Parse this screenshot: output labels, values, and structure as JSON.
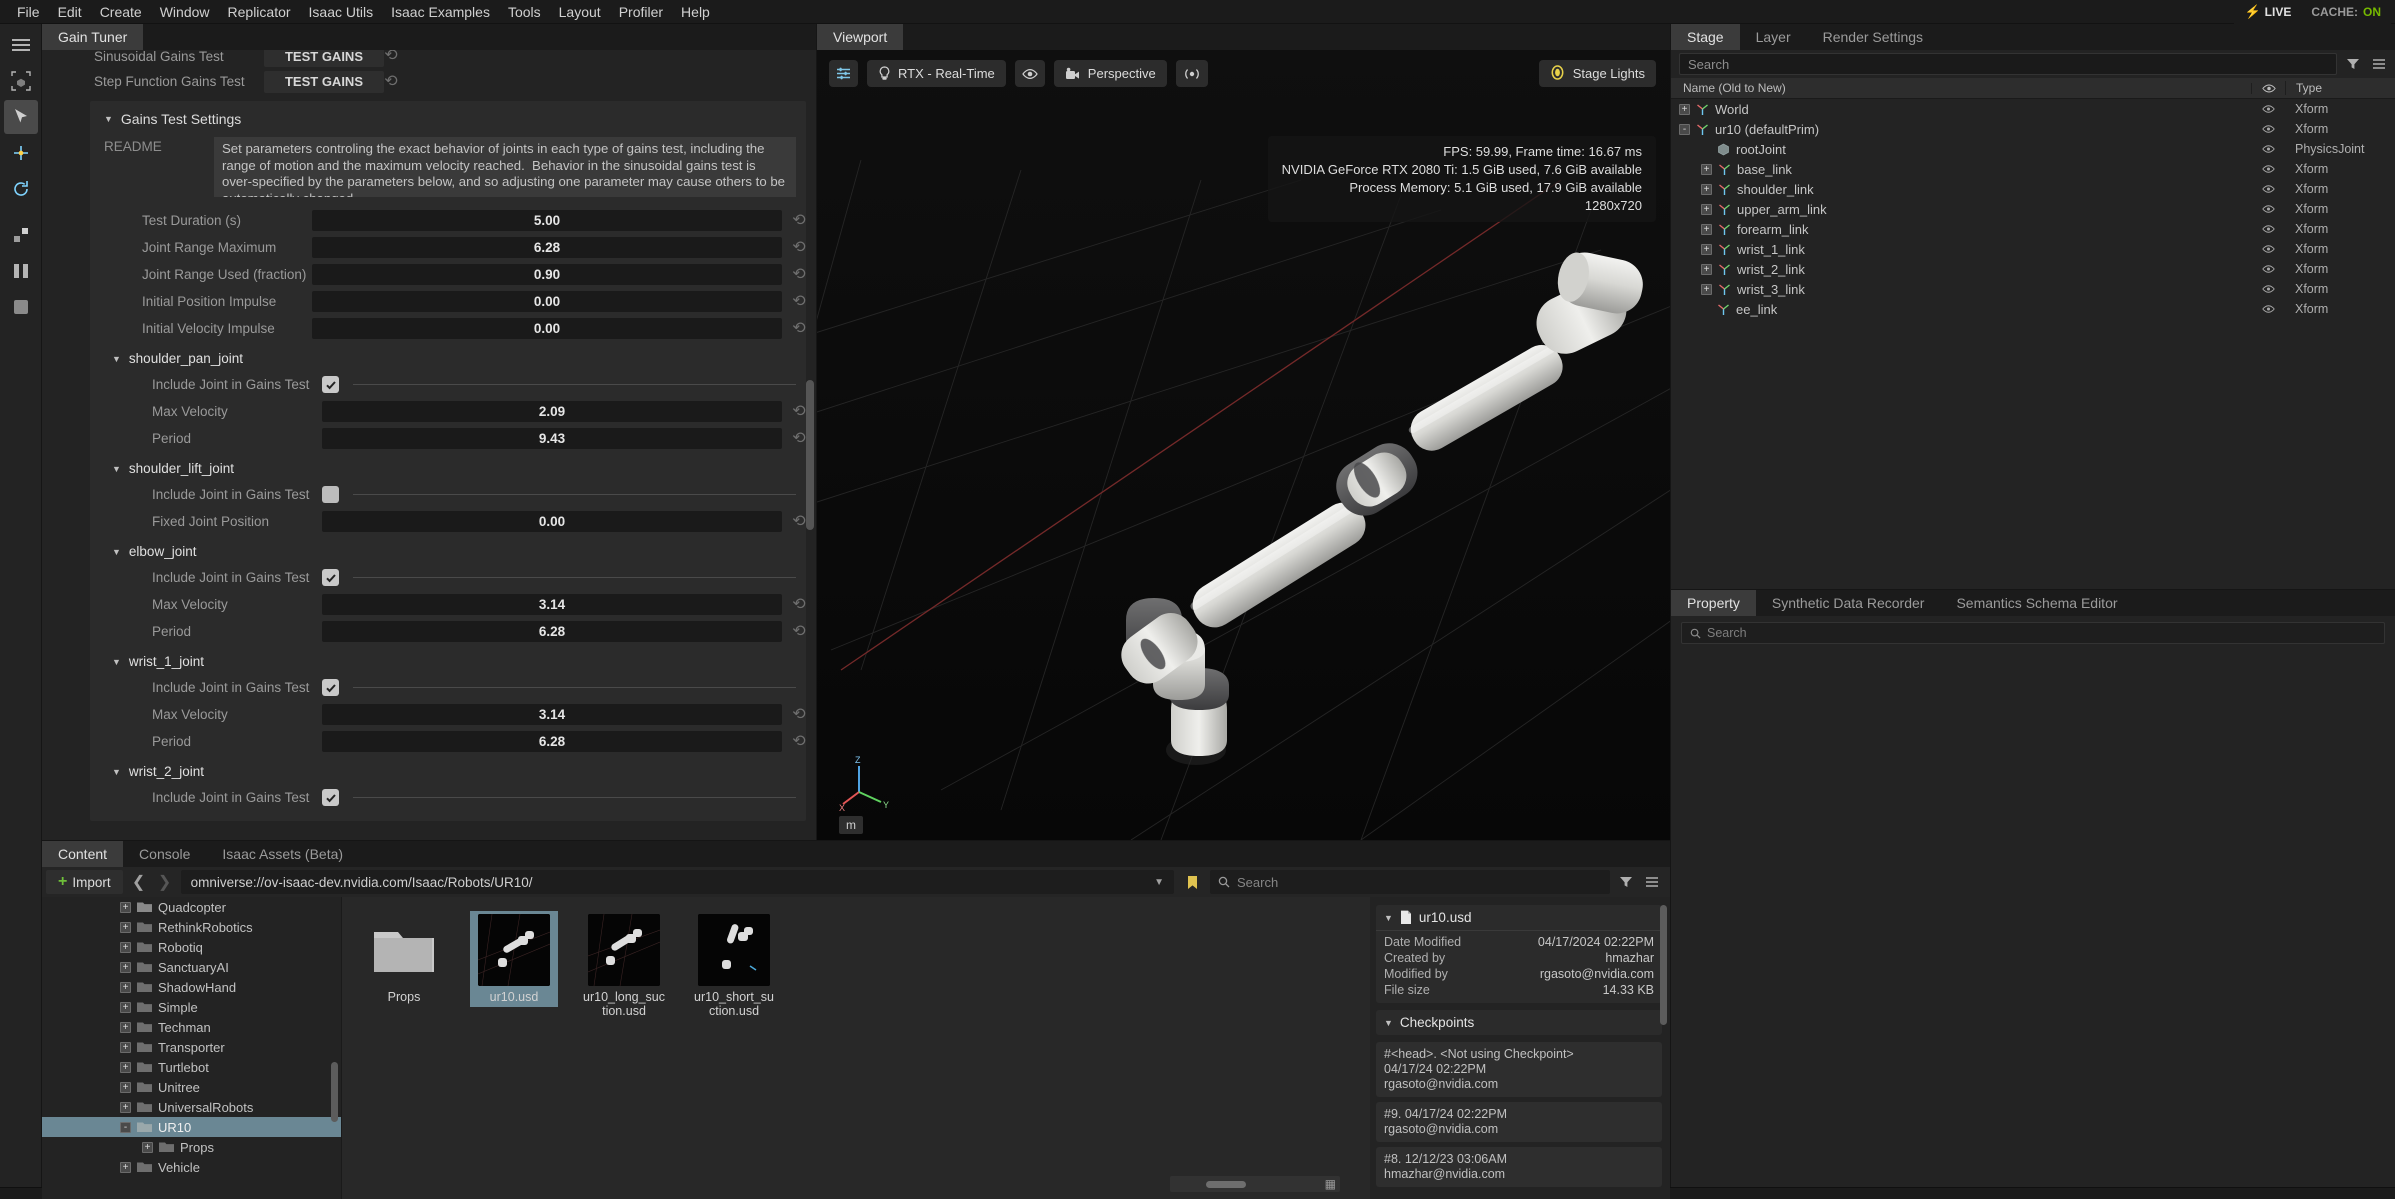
{
  "menubar": {
    "items": [
      "File",
      "Edit",
      "Create",
      "Window",
      "Replicator",
      "Isaac Utils",
      "Isaac Examples",
      "Tools",
      "Layout",
      "Profiler",
      "Help"
    ],
    "live_label": "LIVE",
    "cache_label": "CACHE:",
    "cache_state": "ON",
    "accent_green": "#76b900",
    "accent_yellow": "#ffd200"
  },
  "gain_tuner": {
    "tabs": [
      {
        "label": "Gain Tuner",
        "active": true
      }
    ],
    "top_rows": [
      {
        "label": "Sinusoidal Gains Test",
        "button": "TEST GAINS"
      },
      {
        "label": "Step Function Gains Test",
        "button": "TEST GAINS"
      }
    ],
    "settings_group": {
      "title": "Gains Test Settings",
      "readme_label": "README",
      "readme_text": "Set parameters controling the exact behavior of joints in each type of gains test, including the range of motion and the maximum velocity reached.  Behavior in the sinusoidal gains test is over-specified by the parameters below, and so adjusting one parameter may cause others to be automatically changed.\n\nMax Velocity and Period are exclusive to the sinusoidal gains test. Period is bounded below by Max Velocity and",
      "params": [
        {
          "label": "Test Duration (s)",
          "value": "5.00"
        },
        {
          "label": "Joint Range Maximum",
          "value": "6.28"
        },
        {
          "label": "Joint Range Used (fraction)",
          "value": "0.90"
        },
        {
          "label": "Initial Position Impulse",
          "value": "0.00"
        },
        {
          "label": "Initial Velocity Impulse",
          "value": "0.00"
        }
      ],
      "joints": [
        {
          "name": "shoulder_pan_joint",
          "include_label": "Include Joint in Gains Test",
          "included": true,
          "fields": [
            {
              "label": "Max Velocity",
              "value": "2.09"
            },
            {
              "label": "Period",
              "value": "9.43"
            }
          ]
        },
        {
          "name": "shoulder_lift_joint",
          "include_label": "Include Joint in Gains Test",
          "included": false,
          "fields": [
            {
              "label": "Fixed Joint Position",
              "value": "0.00"
            }
          ]
        },
        {
          "name": "elbow_joint",
          "include_label": "Include Joint in Gains Test",
          "included": true,
          "fields": [
            {
              "label": "Max Velocity",
              "value": "3.14"
            },
            {
              "label": "Period",
              "value": "6.28"
            }
          ]
        },
        {
          "name": "wrist_1_joint",
          "include_label": "Include Joint in Gains Test",
          "included": true,
          "fields": [
            {
              "label": "Max Velocity",
              "value": "3.14"
            },
            {
              "label": "Period",
              "value": "6.28"
            }
          ]
        },
        {
          "name": "wrist_2_joint",
          "include_label": "Include Joint in Gains Test",
          "included": true,
          "fields": []
        }
      ]
    }
  },
  "viewport": {
    "tabs": [
      {
        "label": "Viewport",
        "active": true
      }
    ],
    "toolbar": {
      "settings_icon": "sliders-icon",
      "renderer": "RTX - Real-Time",
      "renderer_icon": "lightbulb-icon",
      "visibility_icon": "eye-icon",
      "camera": "Perspective",
      "camera_icon": "camera-icon",
      "sensor_icon": "broadcast-icon"
    },
    "stage_lights": {
      "label": "Stage Lights",
      "icon": "light-bulb-icon"
    },
    "hud": {
      "line1": "FPS: 59.99, Frame time: 16.67 ms",
      "line2": "NVIDIA GeForce RTX 2080 Ti: 1.5 GiB used, 7.6 GiB available",
      "line3": "Process Memory: 5.1 GiB used, 17.9 GiB available",
      "line4": "1280x720"
    },
    "axis": {
      "x": "X",
      "y": "Y",
      "z": "Z",
      "unit": "m"
    }
  },
  "stage": {
    "tabs": [
      {
        "label": "Stage",
        "active": true
      },
      {
        "label": "Layer",
        "active": false
      },
      {
        "label": "Render Settings",
        "active": false
      }
    ],
    "search_placeholder": "Search",
    "filter_icon": "filter-icon",
    "options_icon": "hamburger-icon",
    "columns": {
      "name": "Name (Old to New)",
      "eye": "eye-icon",
      "type": "Type"
    },
    "rows": [
      {
        "name": "World",
        "type": "Xform",
        "depth": 0,
        "expander": "+",
        "icon": "xform-axis-icon"
      },
      {
        "name": "ur10 (defaultPrim)",
        "type": "Xform",
        "depth": 0,
        "expander": "-",
        "icon": "xform-axis-icon"
      },
      {
        "name": "rootJoint",
        "type": "PhysicsJoint",
        "depth": 2,
        "expander": "",
        "icon": "cube-icon"
      },
      {
        "name": "base_link",
        "type": "Xform",
        "depth": 1,
        "expander": "+",
        "icon": "xform-axis-icon"
      },
      {
        "name": "shoulder_link",
        "type": "Xform",
        "depth": 1,
        "expander": "+",
        "icon": "xform-axis-icon"
      },
      {
        "name": "upper_arm_link",
        "type": "Xform",
        "depth": 1,
        "expander": "+",
        "icon": "xform-axis-icon"
      },
      {
        "name": "forearm_link",
        "type": "Xform",
        "depth": 1,
        "expander": "+",
        "icon": "xform-axis-icon"
      },
      {
        "name": "wrist_1_link",
        "type": "Xform",
        "depth": 1,
        "expander": "+",
        "icon": "xform-axis-icon"
      },
      {
        "name": "wrist_2_link",
        "type": "Xform",
        "depth": 1,
        "expander": "+",
        "icon": "xform-axis-icon"
      },
      {
        "name": "wrist_3_link",
        "type": "Xform",
        "depth": 1,
        "expander": "+",
        "icon": "xform-axis-icon"
      },
      {
        "name": "ee_link",
        "type": "Xform",
        "depth": 2,
        "expander": "",
        "icon": "xform-axis-icon"
      }
    ]
  },
  "property": {
    "tabs": [
      {
        "label": "Property",
        "active": true
      },
      {
        "label": "Synthetic Data Recorder",
        "active": false
      },
      {
        "label": "Semantics Schema Editor",
        "active": false
      }
    ],
    "search_placeholder": "Search"
  },
  "content": {
    "tabs": [
      {
        "label": "Content",
        "active": true
      },
      {
        "label": "Console",
        "active": false
      },
      {
        "label": "Isaac Assets (Beta)",
        "active": false
      }
    ],
    "import_label": "Import",
    "path": "omniverse://ov-isaac-dev.nvidia.com/Isaac/Robots/UR10/",
    "search_placeholder": "Search",
    "tree": [
      {
        "label": "Quadcopter",
        "expander": "+",
        "selected": false,
        "indent": false
      },
      {
        "label": "RethinkRobotics",
        "expander": "+",
        "selected": false,
        "indent": false
      },
      {
        "label": "Robotiq",
        "expander": "+",
        "selected": false,
        "indent": false
      },
      {
        "label": "SanctuaryAI",
        "expander": "+",
        "selected": false,
        "indent": false
      },
      {
        "label": "ShadowHand",
        "expander": "+",
        "selected": false,
        "indent": false
      },
      {
        "label": "Simple",
        "expander": "+",
        "selected": false,
        "indent": false
      },
      {
        "label": "Techman",
        "expander": "+",
        "selected": false,
        "indent": false
      },
      {
        "label": "Transporter",
        "expander": "+",
        "selected": false,
        "indent": false
      },
      {
        "label": "Turtlebot",
        "expander": "+",
        "selected": false,
        "indent": false
      },
      {
        "label": "Unitree",
        "expander": "+",
        "selected": false,
        "indent": false
      },
      {
        "label": "UniversalRobots",
        "expander": "+",
        "selected": false,
        "indent": false
      },
      {
        "label": "UR10",
        "expander": "-",
        "selected": true,
        "indent": false
      },
      {
        "label": "Props",
        "expander": "+",
        "selected": false,
        "indent": true
      },
      {
        "label": "Vehicle",
        "expander": "+",
        "selected": false,
        "indent": false
      }
    ],
    "grid": [
      {
        "label": "Props",
        "type": "folder",
        "selected": false
      },
      {
        "label": "ur10.usd",
        "type": "usd",
        "selected": true
      },
      {
        "label": "ur10_long_suction.usd",
        "type": "usd",
        "selected": false
      },
      {
        "label": "ur10_short_suction.usd",
        "type": "usd",
        "selected": false
      }
    ],
    "detail": {
      "file_name": "ur10.usd",
      "file_icon": "document-icon",
      "info": [
        {
          "key": "Date Modified",
          "value": "04/17/2024 02:22PM"
        },
        {
          "key": "Created by",
          "value": "hmazhar"
        },
        {
          "key": "Modified by",
          "value": "rgasoto@nvidia.com"
        },
        {
          "key": "File size",
          "value": "14.33 KB"
        }
      ],
      "checkpoints_title": "Checkpoints",
      "checkpoints": [
        {
          "line1": "#<head>.   <Not using Checkpoint>",
          "line2": "04/17/24 02:22PM",
          "line3": "rgasoto@nvidia.com"
        },
        {
          "line1": "#9.   04/17/24 02:22PM",
          "line2": "rgasoto@nvidia.com",
          "line3": ""
        },
        {
          "line1": "#8.   12/12/23 03:06AM",
          "line2": "hmazhar@nvidia.com",
          "line3": ""
        }
      ]
    }
  }
}
